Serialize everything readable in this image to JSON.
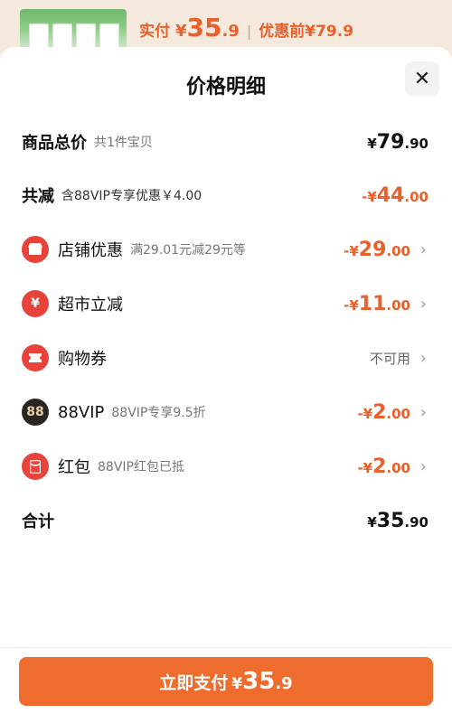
{
  "peek": {
    "label": "实付",
    "currency": "¥",
    "price_int": "35",
    "price_dec": ".9",
    "separator": "|",
    "original": "优惠前¥79.9"
  },
  "sheet": {
    "title": "价格明细",
    "close_icon": "close-icon"
  },
  "rows": {
    "total": {
      "label": "商品总价",
      "sub": "共1件宝贝",
      "currency": "¥",
      "int": "79",
      "dec": ".90"
    },
    "reduced": {
      "label": "共减",
      "sub": "含88VIP专享优惠￥4.00",
      "prefix": "-¥",
      "int": "44",
      "dec": ".00"
    },
    "shop": {
      "label": "店铺优惠",
      "sub": "满29.01元减29元等",
      "prefix": "-¥",
      "int": "29",
      "dec": ".00",
      "icon": "shop-icon"
    },
    "market": {
      "label": "超市立减",
      "prefix": "-¥",
      "int": "11",
      "dec": ".00",
      "icon": "yuan-icon"
    },
    "coupon": {
      "label": "购物券",
      "value": "不可用",
      "icon": "ticket-icon"
    },
    "vip": {
      "label": "88VIP",
      "sub": "88VIP专享9.5折",
      "prefix": "-¥",
      "int": "2",
      "dec": ".00",
      "icon": "vip-88-icon",
      "badge": "88"
    },
    "redpack": {
      "label": "红包",
      "sub": "88VIP红包已抵",
      "prefix": "-¥",
      "int": "2",
      "dec": ".00",
      "icon": "red-envelope-icon"
    },
    "sum": {
      "label": "合计",
      "currency": "¥",
      "int": "35",
      "dec": ".90"
    }
  },
  "pay_button": {
    "label": "立即支付",
    "currency": "¥",
    "int": "35",
    "dec": ".9"
  },
  "colors": {
    "accent": "#ef6c2f",
    "discount": "#e8602c",
    "icon_red": "#e8433a"
  }
}
